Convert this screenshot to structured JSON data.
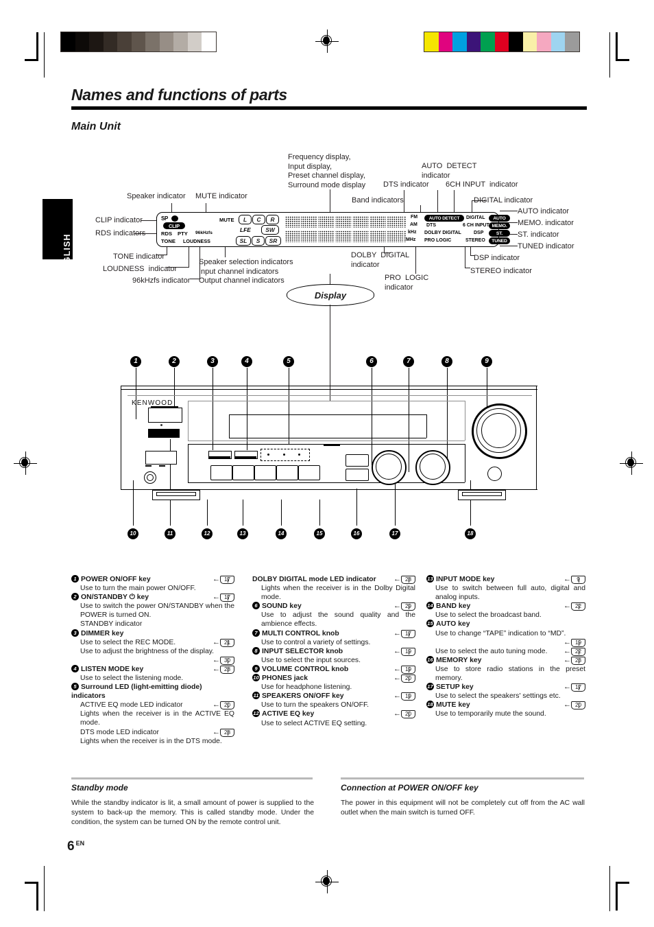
{
  "meta": {
    "language_tab": "ENGLISH",
    "page_number": "6",
    "page_suffix": "EN"
  },
  "header": {
    "title": "Names and functions of parts",
    "section": "Main Unit"
  },
  "diagram": {
    "display_oval_label": "Display",
    "callouts": {
      "freq_display": "Frequency display,\nInput display,\nPreset channel display,\nSurround mode display",
      "auto_detect": "AUTO  DETECT\nindicator",
      "dts_indicator": "DTS indicator",
      "sixch_input": "6CH INPUT  indicator",
      "band_indicators": "Band indicators",
      "digital_indicator": "DIGITAL indicator",
      "auto_indicator": "AUTO indicator",
      "memo_indicator": "MEMO. indicator",
      "st_indicator": "ST. indicator",
      "tuned_indicator": "TUNED indicator",
      "dsp_indicator": "DSP indicator",
      "stereo_indicator": "STEREO indicator",
      "dolby_digital": "DOLBY  DIGITAL\nindicator",
      "pro_logic": "PRO  LOGIC\nindicator",
      "speaker_indicator": "Speaker indicator",
      "mute_indicator": "MUTE indicator",
      "clip_indicator": "CLIP indicator",
      "rds_indicators": "RDS indicators",
      "tone_indicator": "TONE indicator",
      "loudness_indicator": "LOUDNESS  indicator",
      "khz_indicator": "96kHzfs indicator",
      "speaker_selection": "Speaker selection indicators\nInput channel indicators\nOutput channel indicators"
    },
    "lcd": {
      "sp_label": "SP",
      "clip": "CLIP",
      "rds": "RDS",
      "pty": "PTY",
      "tone": "TONE",
      "loudness": "LOUDNESS",
      "khz": "96kHzfs",
      "mute": "MUTE",
      "channels_row1": [
        "L",
        "C",
        "R"
      ],
      "lfe": "LFE",
      "sw": "SW",
      "channels_row3": [
        "SL",
        "S",
        "SR"
      ],
      "bands": [
        "FM",
        "AM",
        "kHz",
        "MHz"
      ],
      "auto_detect": "AUTO DETECT",
      "dts": "DTS",
      "dolby_digital": "DOLBY DIGITAL",
      "pro_logic": "PRO LOGIC",
      "digital": "DIGITAL",
      "six_ch_input": "6 CH INPUT",
      "dsp": "DSP",
      "stereo": "STEREO",
      "auto": "AUTO",
      "memo": "MEMO.",
      "st": "ST.",
      "tuned": "TUNED"
    },
    "unit": {
      "brand": "KENWOOD"
    },
    "numbers_top": [
      "1",
      "2",
      "3",
      "4",
      "5",
      "6",
      "7",
      "8",
      "9"
    ],
    "numbers_bottom": [
      "10",
      "11",
      "12",
      "13",
      "14",
      "15",
      "16",
      "17",
      "18"
    ]
  },
  "parts": {
    "column1": [
      {
        "num": "1",
        "title": "POWER ON/OFF key",
        "page": "17",
        "lines": [
          {
            "text": "Use to turn the main power ON/OFF."
          }
        ]
      },
      {
        "num": "2",
        "title": "ON/STANDBY ⏻ key",
        "page": "17",
        "lines": [
          {
            "text": "Use to switch the power ON/STANDBY when the POWER is turned ON."
          },
          {
            "text": "STANDBY indicator",
            "bold": true
          }
        ]
      },
      {
        "num": "3",
        "title": "DIMMER key",
        "page": "",
        "lines": [
          {
            "text": "Use to select the REC MODE.",
            "page": "21"
          },
          {
            "text": "Use to adjust the brightness of the display.",
            "page": "30",
            "page_own_line": true
          }
        ]
      },
      {
        "num": "4",
        "title": "LISTEN MODE key",
        "page": "28",
        "lines": [
          {
            "text": "Use to select the listening mode."
          }
        ]
      },
      {
        "num": "5",
        "title": "Surround  LED  (light-emitting  diode) indicators",
        "page": "",
        "lines": [
          {
            "text": "ACTIVE EQ mode LED indicator",
            "bold": true,
            "page": "20"
          },
          {
            "text": "Lights when the receiver is in the ACTIVE EQ mode."
          },
          {
            "text": "DTS mode LED indicator",
            "bold": true,
            "page": "28"
          },
          {
            "text": "Lights when the receiver is in the DTS mode."
          }
        ]
      }
    ],
    "column2": [
      {
        "num": "",
        "title": "DOLBY DIGITAL mode LED indicator",
        "page": "28",
        "lines": [
          {
            "text": "Lights when the receiver is in the Dolby Digital mode."
          }
        ]
      },
      {
        "num": "6",
        "title": "SOUND key",
        "page": "29",
        "lines": [
          {
            "text": "Use to adjust the sound quality and the ambience effects."
          }
        ]
      },
      {
        "num": "7",
        "title": "MULTI CONTROL knob",
        "page": "17",
        "lines": [
          {
            "text": "Use to control a variety of settings."
          }
        ]
      },
      {
        "num": "8",
        "title": "INPUT SELECTOR knob",
        "page": "19",
        "lines": [
          {
            "text": "Use to select the input sources."
          }
        ]
      },
      {
        "num": "9",
        "title": "VOLUME CONTROL knob",
        "page": "19",
        "lines": []
      },
      {
        "num": "10",
        "title": "PHONES jack",
        "page": "20",
        "lines": [
          {
            "text": "Use for headphone listening."
          }
        ]
      },
      {
        "num": "11",
        "title": "SPEAKERS ON/OFF key",
        "page": "19",
        "lines": [
          {
            "text": "Use to turn the speakers ON/OFF."
          }
        ]
      },
      {
        "num": "12",
        "title": "ACTIVE EQ key",
        "page": "20",
        "lines": [
          {
            "text": "Use to select ACTIVE EQ setting."
          }
        ]
      }
    ],
    "column3": [
      {
        "num": "13",
        "title": "INPUT MODE key",
        "page": "9",
        "lines": [
          {
            "text": "Use to switch between full auto, digital and analog inputs."
          }
        ]
      },
      {
        "num": "14",
        "title": "BAND key",
        "page": "22",
        "lines": [
          {
            "text": "Use to select the broadcast band."
          }
        ]
      },
      {
        "num": "15",
        "title": "AUTO key",
        "page": "",
        "lines": [
          {
            "text": "Use to change “TAPE” indication to “MD”.",
            "page": "19",
            "page_own_line": true
          },
          {
            "text": "Use to select the auto tuning mode.",
            "page": "22"
          }
        ]
      },
      {
        "num": "16",
        "title": "MEMORY key",
        "page": "23",
        "lines": [
          {
            "text": "Use to store radio stations in the preset memory."
          }
        ]
      },
      {
        "num": "17",
        "title": "SETUP key",
        "page": "17",
        "lines": [
          {
            "text": "Use to select the speakers' settings etc."
          }
        ]
      },
      {
        "num": "18",
        "title": "MUTE key",
        "page": "20",
        "lines": [
          {
            "text": "Use to temporarily mute the sound."
          }
        ]
      }
    ]
  },
  "notes": {
    "standby": {
      "heading": "Standby mode",
      "body": "While the standby indicator is lit, a small amount of power is supplied to the system to  back-up the memory. This is called standby mode. Under the condition, the system can be turned ON by the remote control unit."
    },
    "connection": {
      "heading": "Connection at POWER ON/OFF key",
      "body": "The power in this equipment will not be completely cut off from the AC wall outlet when the main switch is turned OFF."
    }
  },
  "print_marks": {
    "grayscale_bar": [
      "#000000",
      "#0d0a08",
      "#1d1713",
      "#332b25",
      "#4a4038",
      "#5f554c",
      "#7b7269",
      "#978e86",
      "#b3aca5",
      "#d2cdc8",
      "#ffffff"
    ],
    "color_bar": [
      "#f5e600",
      "#e0047f",
      "#00a0e0",
      "#3c1478",
      "#00a050",
      "#e00020",
      "#000000",
      "#f9f0a8",
      "#f5a8c0",
      "#9ed4f0",
      "#9b9b9b"
    ]
  }
}
